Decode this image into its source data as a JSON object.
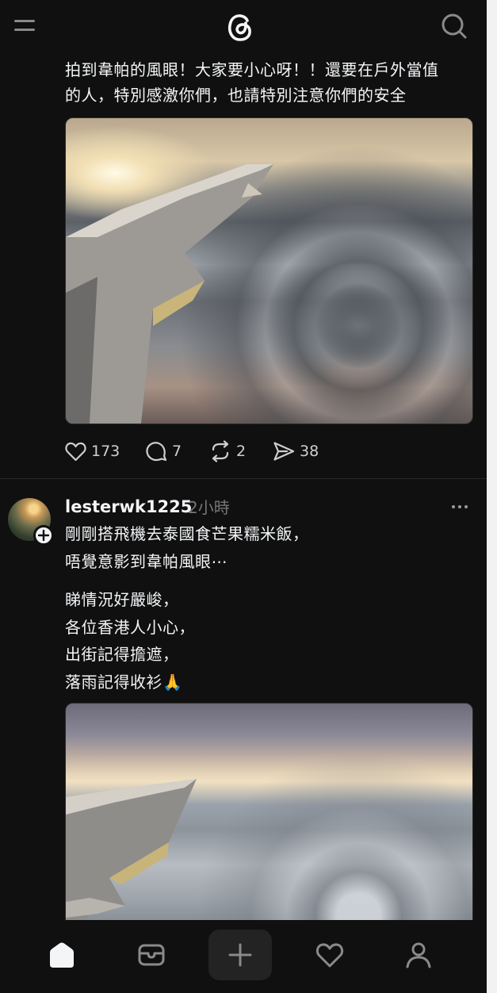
{
  "header": {
    "menu_icon": "menu-icon",
    "logo_icon": "threads-logo-icon",
    "search_icon": "search-icon"
  },
  "post1": {
    "caption_lines": [
      "拍到韋帕的風眼！大家要小心呀！！還要在戶外當值",
      "的人，特別感激你們，也請特別注意你們的安全"
    ],
    "stats": {
      "likes": "173",
      "replies": "7",
      "reposts": "2",
      "shares": "38"
    }
  },
  "post2": {
    "username": "lesterwk1225",
    "time": "2小時",
    "caption_lines": [
      "剛剛搭飛機去泰國食芒果糯米飯，",
      "唔覺意影到韋帕風眼⋯",
      "",
      "睇情況好嚴峻，",
      "各位香港人小心，",
      "出街記得擔遮，",
      "落雨記得收衫🙏"
    ]
  },
  "bottom_nav": {
    "items": [
      "home-icon",
      "inbox-icon",
      "new-post-icon",
      "activity-icon",
      "profile-icon"
    ]
  },
  "colors": {
    "background": "#101010",
    "text": "#f3f5f7",
    "muted": "#777777"
  }
}
